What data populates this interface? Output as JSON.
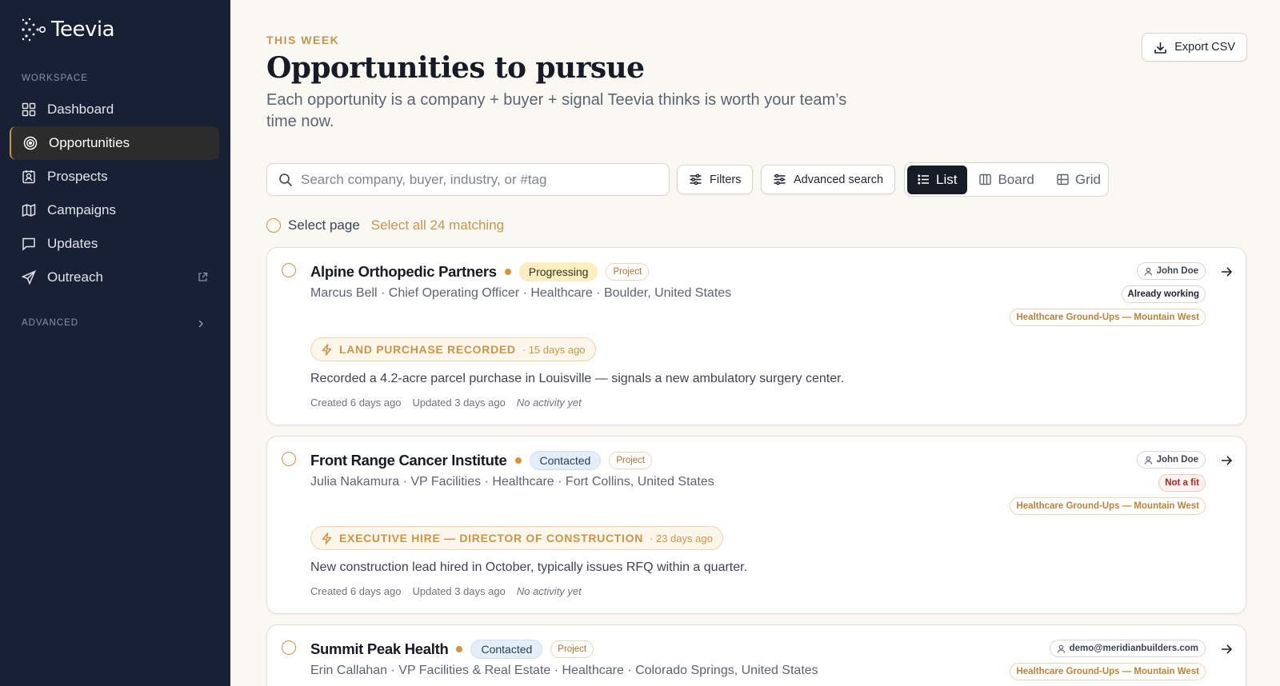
{
  "brand": {
    "name": "Teevia"
  },
  "sidebar": {
    "workspace_label": "WORKSPACE",
    "items": [
      {
        "label": "Dashboard",
        "icon": "dashboard-icon"
      },
      {
        "label": "Opportunities",
        "icon": "target-icon",
        "active": true
      },
      {
        "label": "Prospects",
        "icon": "contact-icon"
      },
      {
        "label": "Campaigns",
        "icon": "map-icon"
      },
      {
        "label": "Updates",
        "icon": "message-icon"
      },
      {
        "label": "Outreach",
        "icon": "send-icon",
        "external": true
      }
    ],
    "advanced_label": "ADVANCED"
  },
  "header": {
    "eyebrow": "THIS WEEK",
    "title": "Opportunities to pursue",
    "subtitle": "Each opportunity is a company + buyer + signal Teevia thinks is worth your team’s time now.",
    "export_label": "Export CSV"
  },
  "toolbar": {
    "search_placeholder": "Search company, buyer, industry, or #tag",
    "filters_label": "Filters",
    "advanced_search_label": "Advanced search",
    "views": [
      "List",
      "Board",
      "Grid"
    ],
    "active_view": "List"
  },
  "selection": {
    "select_page_label": "Select page",
    "select_all_label": "Select all 24 matching"
  },
  "colors": {
    "sidebar_bg": "#182035",
    "accent": "#c9954a",
    "background": "#faf8f3"
  },
  "opportunities": [
    {
      "company": "Alpine Orthopedic Partners",
      "status": "Progressing",
      "tag": "Project",
      "meta": "Marcus Bell · Chief Operating Officer · Healthcare · Boulder, United States",
      "signal_label": "LAND PURCHASE RECORDED",
      "signal_age": "· 15 days ago",
      "description": "Recorded a 4.2-acre parcel purchase in Louisville — signals a new ambulatory surgery center.",
      "created": "Created 6 days ago",
      "updated": "Updated 3 days ago",
      "activity": "No activity yet",
      "owner": "John Doe",
      "account_status": "Already working",
      "segment": "Healthcare Ground-Ups — Mountain West"
    },
    {
      "company": "Front Range Cancer Institute",
      "status": "Contacted",
      "tag": "Project",
      "meta": "Julia Nakamura · VP Facilities · Healthcare · Fort Collins, United States",
      "signal_label": "EXECUTIVE HIRE — DIRECTOR OF CONSTRUCTION",
      "signal_age": "· 23 days ago",
      "description": "New construction lead hired in October, typically issues RFQ within a quarter.",
      "created": "Created 6 days ago",
      "updated": "Updated 3 days ago",
      "activity": "No activity yet",
      "owner": "John Doe",
      "account_status": "Not a fit",
      "segment": "Healthcare Ground-Ups — Mountain West"
    },
    {
      "company": "Summit Peak Health",
      "status": "Contacted",
      "tag": "Project",
      "meta": "Erin Callahan · VP Facilities & Real Estate · Healthcare · Colorado Springs, United States",
      "owner": "demo@meridianbuilders.com",
      "segment": "Healthcare Ground-Ups — Mountain West"
    }
  ]
}
